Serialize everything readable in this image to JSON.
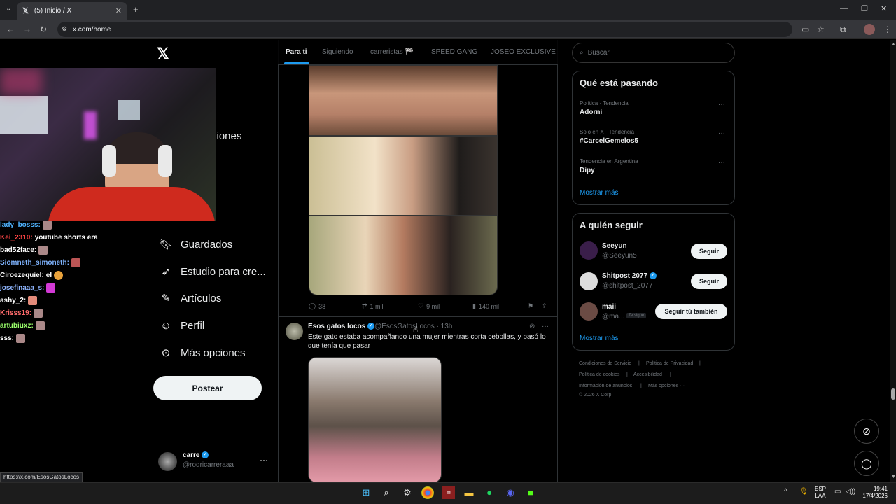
{
  "browser": {
    "tab_title": "(5) Inicio / X",
    "url": "x.com/home",
    "status_url": "https://x.com/EsosGatosLocos"
  },
  "overlay": {
    "partial_nav_text": "ciones",
    "chat": [
      {
        "user": "lady_bosss:",
        "msg": ""
      },
      {
        "user": "Kei_2310:",
        "msg": "youtube shorts era"
      },
      {
        "user": "bad52face:",
        "msg": ""
      },
      {
        "user": "Siomneth_simoneth:",
        "msg": ""
      },
      {
        "user": "Ciroezequiel:",
        "msg": "el"
      },
      {
        "user": "josefinaaa_s:",
        "msg": ""
      },
      {
        "user": "ashy_2:",
        "msg": ""
      },
      {
        "user": "Krisss19:",
        "msg": ""
      },
      {
        "user": "artubiuxz:",
        "msg": ""
      },
      {
        "user": "sss:",
        "msg": ""
      }
    ]
  },
  "sidebar": {
    "logo": "X",
    "items": [
      {
        "label": "Guardados"
      },
      {
        "label": "Estudio para cre..."
      },
      {
        "label": "Artículos"
      },
      {
        "label": "Perfil"
      },
      {
        "label": "Más opciones"
      }
    ],
    "post_button": "Postear",
    "account": {
      "name": "carre",
      "handle": "@rodricarreraaa"
    }
  },
  "feed": {
    "tabs": [
      "Para ti",
      "Siguiendo",
      "carreristas 🏁",
      "SPEED GANG",
      "JOSEO EXCLUSIVE C"
    ],
    "tweet1_actions": {
      "replies": "38",
      "reposts": "1 mil",
      "likes": "9 mil",
      "views": "140 mil"
    },
    "tweet2": {
      "name": "Esos gatos locos",
      "handle": "@EsosGatosLocos",
      "time": "13h",
      "text": "Este gato estaba acompañando una mujer mientras corta cebollas, y pasó lo que tenía que pasar"
    }
  },
  "right": {
    "search_placeholder": "Buscar",
    "trends_title": "Qué está pasando",
    "trends": [
      {
        "meta": "Política · Tendencia",
        "name": "Adorni"
      },
      {
        "meta": "Solo en X · Tendencia",
        "name": "#CarcelGemelos5"
      },
      {
        "meta": "Tendencia en Argentina",
        "name": "Dipy"
      }
    ],
    "show_more": "Mostrar más",
    "follow_title": "A quién seguir",
    "follow": [
      {
        "name": "Seeyun",
        "handle": "@Seeyun5",
        "button": "Seguir",
        "follows_you": ""
      },
      {
        "name": "Shitpost 2077",
        "handle": "@shitpost_2077",
        "button": "Seguir",
        "follows_you": ""
      },
      {
        "name": "maii",
        "handle": "@ma...",
        "button": "Seguir tú también",
        "follows_you": "Te sigue"
      }
    ],
    "footer": [
      "Condiciones de Servicio",
      "Política de Privacidad",
      "Política de cookies",
      "Accesibilidad",
      "Información de anuncios",
      "Más opciones ···",
      "© 2026 X Corp."
    ]
  },
  "taskbar": {
    "lang": "ESP",
    "lang2": "LAA",
    "time": "19:41",
    "date": "17/4/2026"
  }
}
